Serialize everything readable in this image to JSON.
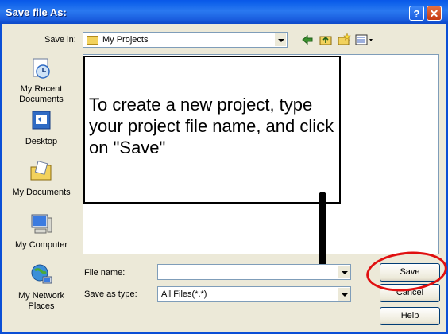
{
  "window": {
    "title": "Save file As:",
    "help_button": "?",
    "close_button": "✕"
  },
  "toolbar": {
    "save_in_label": "Save in:",
    "save_in_value": "My Projects",
    "tools": [
      "back-icon",
      "up-folder-icon",
      "new-folder-icon",
      "view-menu-icon"
    ]
  },
  "places": [
    {
      "label": "My Recent Documents",
      "icon": "recent-documents-icon"
    },
    {
      "label": "Desktop",
      "icon": "desktop-icon"
    },
    {
      "label": "My Documents",
      "icon": "my-documents-icon"
    },
    {
      "label": "My Computer",
      "icon": "my-computer-icon"
    },
    {
      "label": "My Network Places",
      "icon": "network-places-icon"
    }
  ],
  "annotation": {
    "text": "To create a new project, type your project file name, and click on \"Save\"",
    "circle_color": "#e01010"
  },
  "fields": {
    "file_name_label": "File name:",
    "file_name_value": "",
    "save_as_type_label": "Save as type:",
    "save_as_type_value": "All Files(*.*)"
  },
  "buttons": {
    "save": "Save",
    "cancel": "Cancel",
    "help": "Help"
  },
  "colors": {
    "titlebar": "#0a58e8",
    "dialog_bg": "#ece9d8"
  }
}
